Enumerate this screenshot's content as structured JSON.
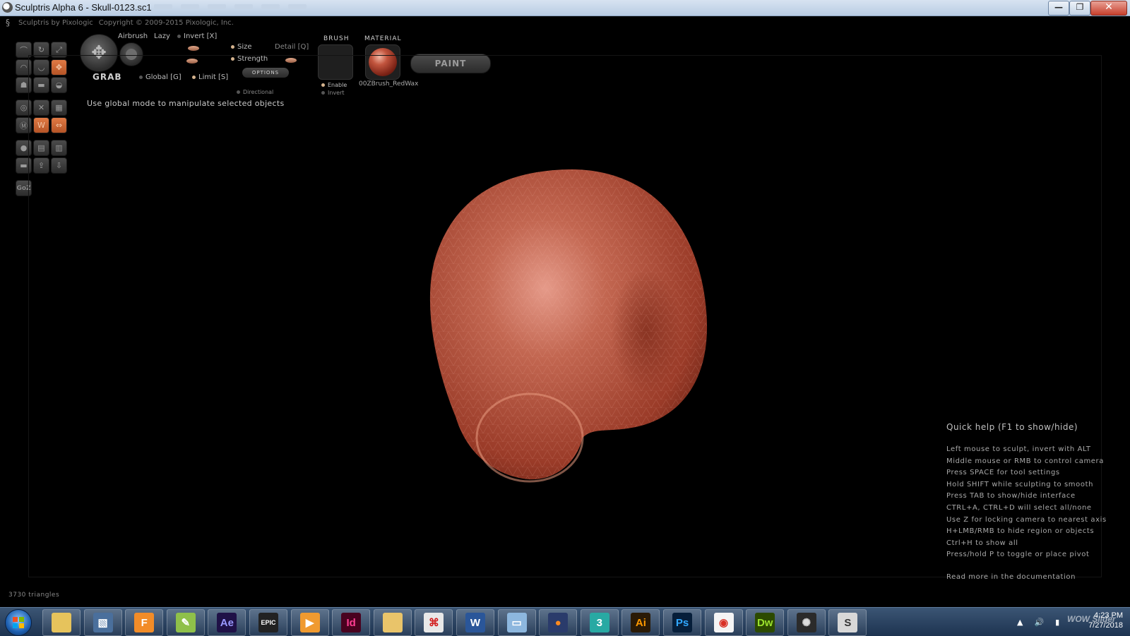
{
  "window": {
    "title": "Sculptris Alpha 6 - Skull-0123.sc1",
    "min_glyph": "—",
    "max_glyph": "❐",
    "close_glyph": "✕"
  },
  "app_header": {
    "brand": "Sculptris by Pixologic",
    "copyright": "Copyright © 2009-2015 Pixologic, Inc."
  },
  "toolbar": {
    "current_tool": "GRAB",
    "airbrush": "Airbrush",
    "lazy": "Lazy",
    "invert": "Invert [X]",
    "size": "Size",
    "strength": "Strength",
    "detail": "Detail [Q]",
    "global": "Global [G]",
    "limit": "Limit [S]",
    "options": "OPTIONS",
    "directional": "Directional",
    "hint": "Use global mode to manipulate selected objects"
  },
  "brush": {
    "label": "BRUSH",
    "enable": "Enable",
    "invert": "Invert"
  },
  "material": {
    "label": "MATERIAL",
    "name": "00ZBrush_RedWax"
  },
  "paint_button": "PAINT",
  "tools": [
    {
      "icon": "draw-icon",
      "active": false
    },
    {
      "icon": "rotate-icon",
      "active": false
    },
    {
      "icon": "scale-icon",
      "active": false
    },
    {
      "icon": "inflate-icon",
      "active": false
    },
    {
      "icon": "pinch-icon",
      "active": false
    },
    {
      "icon": "grab-icon",
      "active": true
    },
    {
      "icon": "smooth-icon",
      "active": false
    },
    {
      "icon": "flatten-icon",
      "active": false
    },
    {
      "icon": "crease-icon",
      "active": false
    },
    {
      "icon": "reduce-brush-icon",
      "active": false
    },
    {
      "icon": "reduce-selected-icon",
      "active": false
    },
    {
      "icon": "subdivide-icon",
      "active": false
    },
    {
      "icon": "mask-icon",
      "active": false
    },
    {
      "icon": "wireframe-icon",
      "active": true
    },
    {
      "icon": "symmetry-icon",
      "active": true
    },
    {
      "icon": "new-sphere-icon",
      "active": false
    },
    {
      "icon": "open-icon",
      "active": false
    },
    {
      "icon": "save-icon",
      "active": false
    },
    {
      "icon": "new-plane-icon",
      "active": false
    },
    {
      "icon": "export-icon",
      "active": false
    },
    {
      "icon": "import-icon",
      "active": false
    },
    {
      "icon": "goz-icon",
      "active": false,
      "label": "GoZ"
    }
  ],
  "quick_help": {
    "title": "Quick help (F1 to show/hide)",
    "lines": [
      "Left mouse to sculpt, invert with ALT",
      "Middle mouse or RMB to control camera",
      "Press SPACE for tool settings",
      "Hold SHIFT while sculpting to smooth",
      "Press TAB to show/hide interface",
      "CTRL+A, CTRL+D will select all/none",
      "Use Z for locking camera to nearest axis",
      "H+LMB/RMB to hide region or objects",
      "Ctrl+H to show all",
      "Press/hold P to toggle or place pivot"
    ],
    "more": "Read more in the documentation"
  },
  "status": {
    "triangles": "3730 triangles"
  },
  "colors": {
    "accent": "#d86b37",
    "model": "#b4523c",
    "background": "#000000"
  },
  "taskbar": {
    "apps": [
      {
        "name": "file-explorer-folder",
        "label": "",
        "bg": "#e6c35c",
        "fg": "#fff"
      },
      {
        "name": "3d-builder",
        "label": "▧",
        "bg": "#4a6f9c",
        "fg": "#fff"
      },
      {
        "name": "fusion",
        "label": "F",
        "bg": "#f28c28",
        "fg": "#fff"
      },
      {
        "name": "sticky-notes",
        "label": "✎",
        "bg": "#8fc04a",
        "fg": "#fff"
      },
      {
        "name": "after-effects",
        "label": "Ae",
        "bg": "#1f1147",
        "fg": "#9999ff"
      },
      {
        "name": "epic-games",
        "label": "EPIC",
        "bg": "#222222",
        "fg": "#fff"
      },
      {
        "name": "media-player",
        "label": "▶",
        "bg": "#f09a30",
        "fg": "#fff"
      },
      {
        "name": "indesign",
        "label": "Id",
        "bg": "#49021f",
        "fg": "#ff3e93"
      },
      {
        "name": "folder",
        "label": "",
        "bg": "#e9c46a",
        "fg": "#fff"
      },
      {
        "name": "acrobat",
        "label": "⌘",
        "bg": "#e8e8e8",
        "fg": "#d21a1a"
      },
      {
        "name": "word",
        "label": "W",
        "bg": "#2a5699",
        "fg": "#fff"
      },
      {
        "name": "explorer-window",
        "label": "▭",
        "bg": "#8db7de",
        "fg": "#fff"
      },
      {
        "name": "firefox",
        "label": "●",
        "bg": "#2a3b6b",
        "fg": "#ff8a1f"
      },
      {
        "name": "3ds-max",
        "label": "3",
        "bg": "#28a9a3",
        "fg": "#fff"
      },
      {
        "name": "illustrator",
        "label": "Ai",
        "bg": "#2a1a06",
        "fg": "#ff9a00"
      },
      {
        "name": "photoshop",
        "label": "Ps",
        "bg": "#061e3a",
        "fg": "#31a8ff"
      },
      {
        "name": "chrome",
        "label": "◉",
        "bg": "#f4f4f4",
        "fg": "#d93025"
      },
      {
        "name": "dreamweaver",
        "label": "Dw",
        "bg": "#2c4a00",
        "fg": "#9be22d"
      },
      {
        "name": "blender-like",
        "label": "✺",
        "bg": "#2b2b2b",
        "fg": "#ddd"
      },
      {
        "name": "sculptris",
        "label": "S",
        "bg": "#d8d8d8",
        "fg": "#333"
      }
    ],
    "time": "4:23 PM",
    "date": "7/27/2018",
    "watermark": "WOW Slider"
  }
}
